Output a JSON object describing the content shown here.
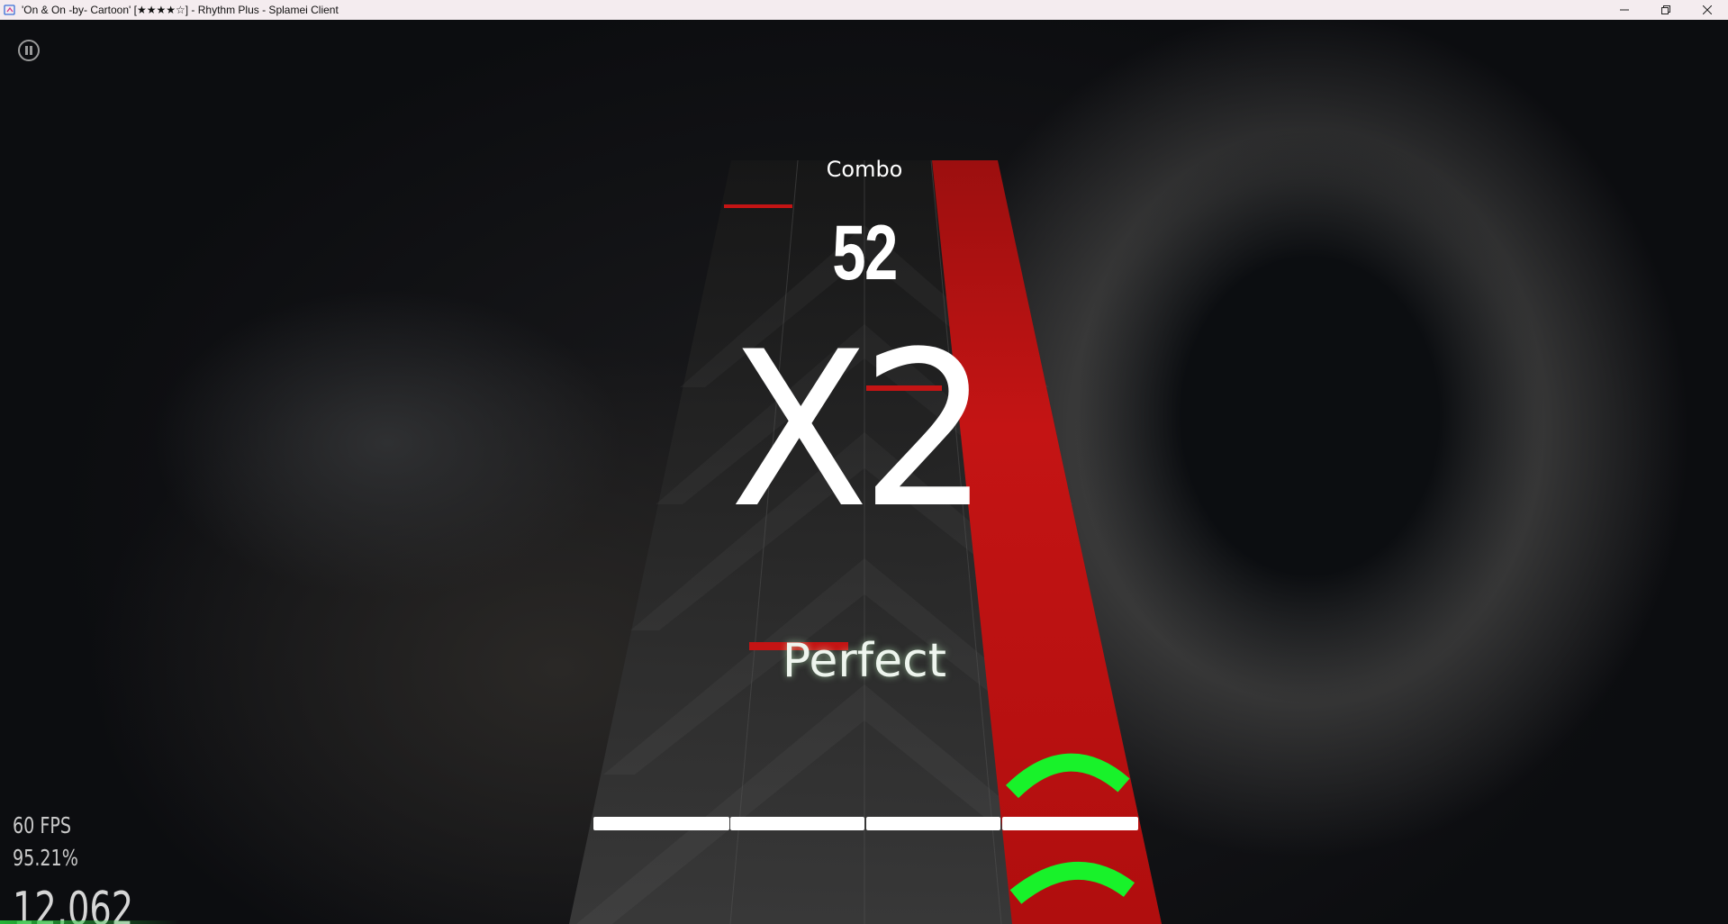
{
  "window": {
    "title": "'On & On -by- Cartoon' [★★★★☆] - Rhythm Plus - Splamei Client",
    "controls": [
      "minimize-icon",
      "restore-icon",
      "close-icon"
    ]
  },
  "song_progress": 0.15,
  "hud": {
    "combo_label": "Combo",
    "combo_value": "52",
    "multiplier": "X2",
    "judgement": "Perfect",
    "fps": "60 FPS",
    "accuracy": "95.21%",
    "score": "12,062"
  },
  "colors": {
    "lane_active": "#c0100f",
    "hit_indicator": "#18f22a",
    "judgement_line": "#ffffff",
    "titlebar": "#f4ecef"
  },
  "icons": {
    "pause": "pause-icon",
    "app": "app-icon"
  }
}
